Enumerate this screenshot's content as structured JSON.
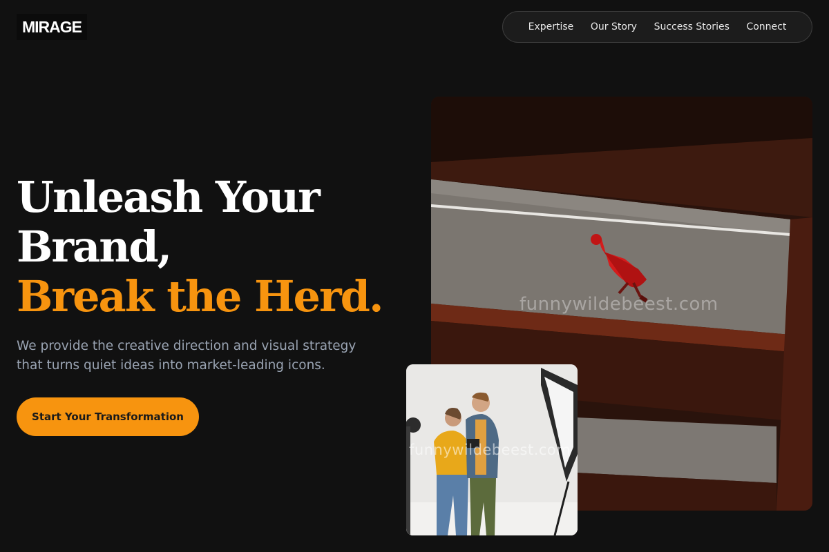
{
  "brand": {
    "logo_text": "MIRAGE"
  },
  "nav": {
    "items": [
      {
        "label": "Expertise"
      },
      {
        "label": "Our Story"
      },
      {
        "label": "Success Stories"
      },
      {
        "label": "Connect"
      }
    ]
  },
  "hero": {
    "headline_line1": "Unleash Your",
    "headline_line2": "Brand,",
    "headline_line3": "Break the Herd.",
    "subtitle": "We provide the creative direction and visual strategy that turns quiet ideas into market-leading icons.",
    "cta_label": "Start Your Transformation"
  },
  "images": {
    "main_watermark": "funnywildebeest.com",
    "small_watermark": "funnywildebeest.com"
  },
  "colors": {
    "background": "#111111",
    "accent": "#f7940f",
    "subtitle": "#9aa4b3"
  }
}
